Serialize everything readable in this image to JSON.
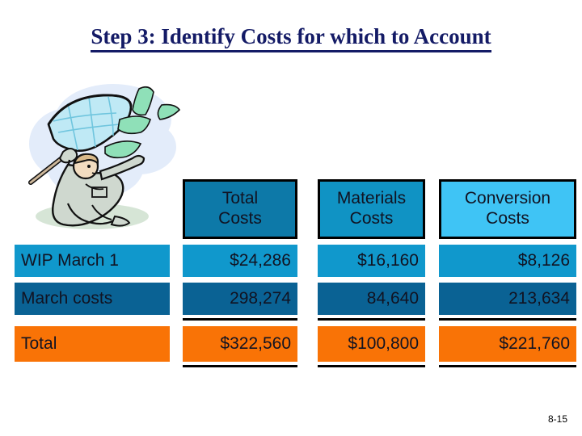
{
  "slide": {
    "title": "Step 3: Identify Costs for which to Account",
    "page_number": "8-15"
  },
  "illustration": {
    "name": "person-catching-money-with-net",
    "description": "Clipart of a person kneeling and catching flying banknotes with a butterfly net"
  },
  "table": {
    "row_header_label": "",
    "columns": [
      {
        "id": "total",
        "line1": "Total",
        "line2": "Costs",
        "color": "#0d79a8"
      },
      {
        "id": "materials",
        "line1": "Materials",
        "line2": "Costs",
        "color": "#1093c4"
      },
      {
        "id": "conversion",
        "line1": "Conversion",
        "line2": "Costs",
        "color": "#3fc4f5"
      }
    ],
    "rows": [
      {
        "label": "WIP March 1",
        "color": "#1098cc",
        "values": [
          "$24,286",
          "$16,160",
          "$8,126"
        ]
      },
      {
        "label": "March costs",
        "color": "#0a6294",
        "values": [
          "298,274",
          "84,640",
          "213,634"
        ]
      },
      {
        "label": "Total",
        "color": "#f97306",
        "values": [
          "$322,560",
          "$100,800",
          "$221,760"
        ]
      }
    ]
  },
  "colors": {
    "title": "#141b66",
    "rule": "#000000",
    "background": "#ffffff"
  }
}
